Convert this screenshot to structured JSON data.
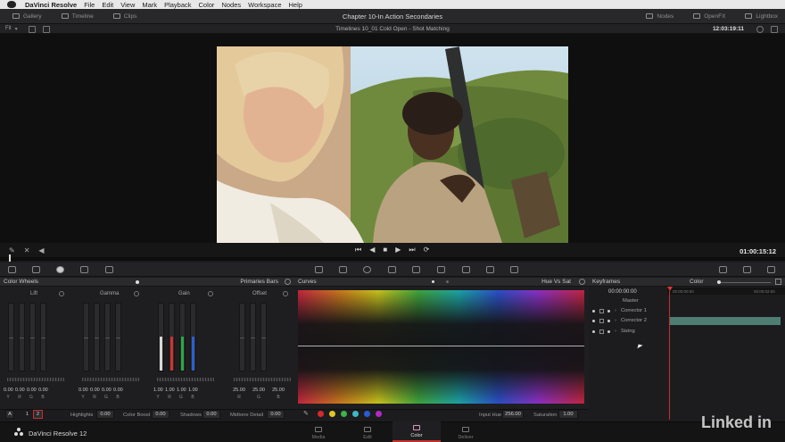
{
  "menubar": {
    "app": "DaVinci Resolve",
    "items": [
      "File",
      "Edit",
      "View",
      "Mark",
      "Playback",
      "Color",
      "Nodes",
      "Workspace",
      "Help"
    ]
  },
  "toolbar": {
    "left": [
      "Gallery",
      "Timeline",
      "Clips"
    ],
    "title": "Chapter 10-In Action Secondaries",
    "right": [
      "Nodes",
      "OpenFX",
      "Lightbox"
    ]
  },
  "viewer": {
    "zoom": "Fit",
    "timeline_name": "Timelines 10_01 Cold Open - Shot Matching",
    "timecode_top": "12:03:19:11",
    "timecode_current": "01:00:15:12"
  },
  "color_wheels": {
    "title": "Color Wheels",
    "mode": "Primaries Bars",
    "wheels": [
      {
        "name": "Lift",
        "values": [
          "0.00",
          "0.00",
          "0.00",
          "0.00"
        ]
      },
      {
        "name": "Gamma",
        "values": [
          "0.00",
          "0.00",
          "0.00",
          "0.00"
        ]
      },
      {
        "name": "Gain",
        "values": [
          "1.00",
          "1.00",
          "1.00",
          "1.00"
        ]
      },
      {
        "name": "Offset",
        "values": [
          "25.00",
          "25.00",
          "25.00"
        ]
      }
    ],
    "channels4": [
      "Y",
      "R",
      "G",
      "B"
    ],
    "channels3": [
      "R",
      "G",
      "B"
    ]
  },
  "adjust": {
    "mode_a": "A",
    "page1": "1",
    "page2": "2",
    "highlights_label": "Highlights",
    "highlights_value": "0.00",
    "color_boost_label": "Color Boost",
    "color_boost_value": "0.00",
    "shadows_label": "Shadows",
    "shadows_value": "0.00",
    "midtone_label": "Midtone Detail",
    "midtone_value": "0.00"
  },
  "curves": {
    "title": "Curves",
    "mode": "Hue Vs Sat",
    "input_hue_label": "Input Hue",
    "input_hue_value": "256.00",
    "saturation_label": "Saturation",
    "saturation_value": "1.00",
    "swatches": [
      "#d62a2a",
      "#e0c52a",
      "#3fb24a",
      "#3fb7c4",
      "#2a5ad6",
      "#b02ac4"
    ]
  },
  "keyframes": {
    "title": "Keyframes",
    "mode": "Color",
    "timecode_start": "00:00:00:00",
    "tick_left": "00:00:00:00",
    "tick_right": "00:00:02:00",
    "rows": [
      "Master",
      "Corrector 1",
      "Corrector 2",
      "Sizing"
    ]
  },
  "footer": {
    "app": "DaVinci Resolve 12",
    "pages": [
      "Media",
      "Edit",
      "Color",
      "Deliver"
    ],
    "active_page": "Color"
  },
  "watermark": "Linked in"
}
